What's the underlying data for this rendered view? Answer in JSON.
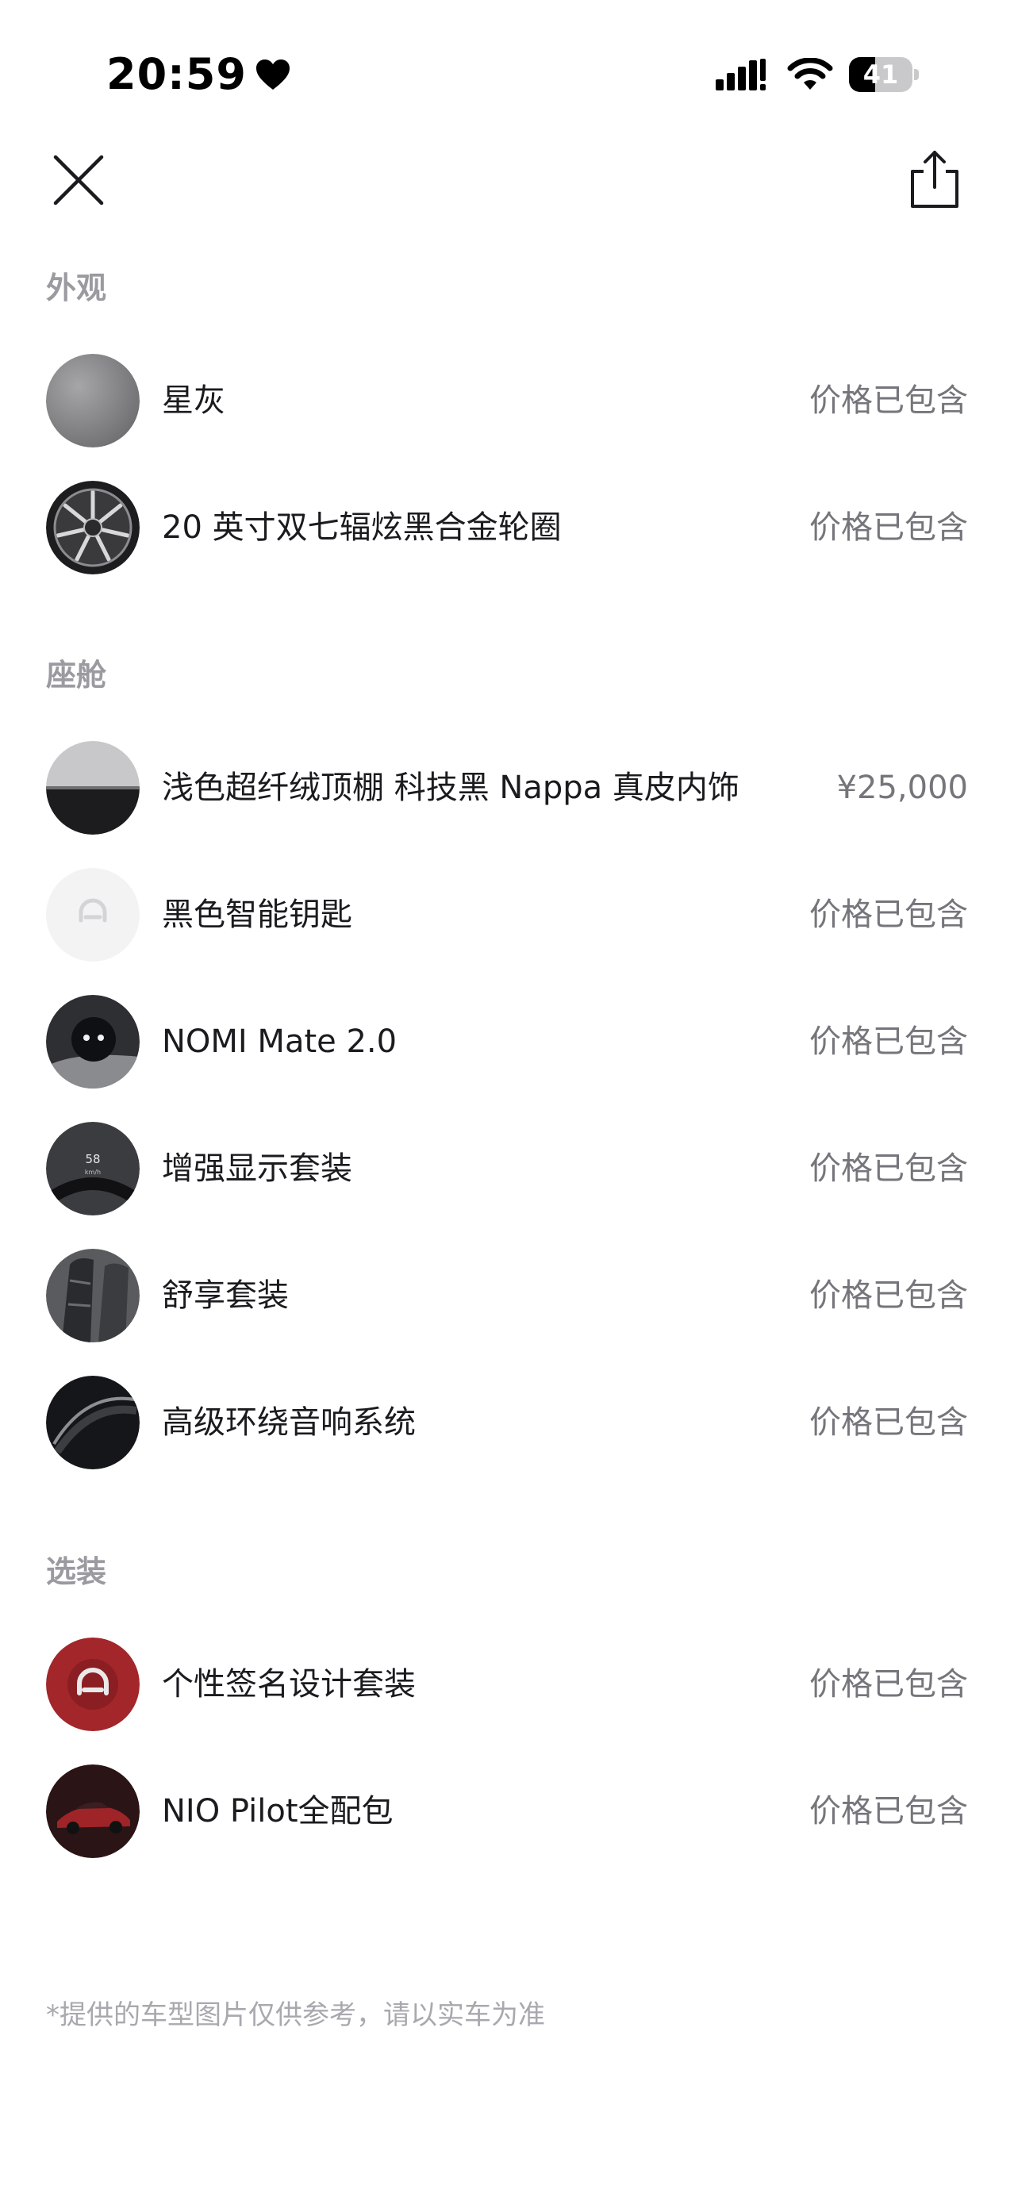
{
  "status_bar": {
    "time": "20:59",
    "battery": "41",
    "battery_level_percent": 41
  },
  "nav": {
    "close_icon": "close-icon",
    "share_icon": "share-icon"
  },
  "sections": {
    "exterior": {
      "title": "外观",
      "items": [
        {
          "label": "星灰",
          "price": "价格已包含"
        },
        {
          "label": "20 英寸双七辐炫黑合金轮圈",
          "price": "价格已包含"
        }
      ]
    },
    "cabin": {
      "title": "座舱",
      "items": [
        {
          "label": "浅色超纤绒顶棚 科技黑 Nappa 真皮内饰",
          "price": "¥25,000"
        },
        {
          "label": "黑色智能钥匙",
          "price": "价格已包含"
        },
        {
          "label": "NOMI Mate 2.0",
          "price": "价格已包含"
        },
        {
          "label": "增强显示套装",
          "price": "价格已包含"
        },
        {
          "label": "舒享套装",
          "price": "价格已包含"
        },
        {
          "label": "高级环绕音响系统",
          "price": "价格已包含"
        }
      ]
    },
    "options": {
      "title": "选装",
      "items": [
        {
          "label": "个性签名设计套装",
          "price": "价格已包含"
        },
        {
          "label": "NIO Pilot全配包",
          "price": "价格已包含"
        }
      ]
    }
  },
  "footer": {
    "note": "*提供的车型图片仅供参考，请以实车为准"
  },
  "thumbnail_text": {
    "hud_speed": "58",
    "hud_unit": "km/h"
  },
  "colors": {
    "price_text": "#75757b",
    "section_title": "#9a9aa0",
    "footer_text": "#a8a8ae",
    "options_badge_red": "#a3262a"
  }
}
